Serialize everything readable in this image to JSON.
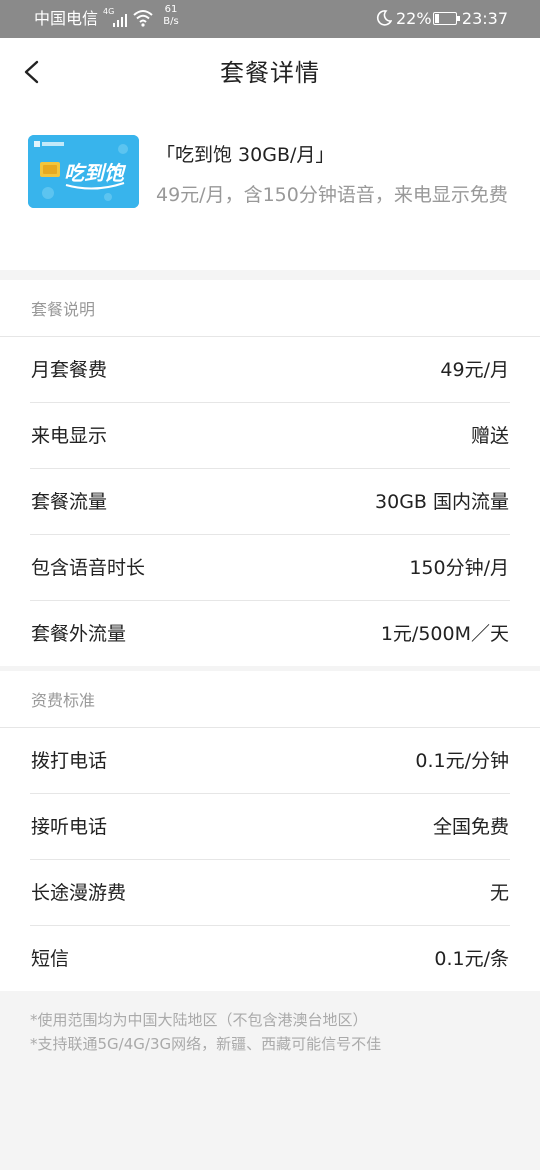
{
  "status_bar": {
    "carrier": "中国电信",
    "network_type": "4G",
    "net_speed_value": "61",
    "net_speed_unit": "B/s",
    "battery_percent": "22%",
    "battery_level": 0.22,
    "time": "23:37",
    "icons": [
      "signal-icon",
      "wifi-icon",
      "moon-icon",
      "battery-icon"
    ]
  },
  "nav": {
    "title": "套餐详情",
    "back_icon": "chevron-left-icon"
  },
  "plan": {
    "name": "「吃到饱 30GB/月」",
    "description": "49元/月，含150分钟语音，来电显示免费",
    "image_text": "吃到饱"
  },
  "plan_info": {
    "header": "套餐说明",
    "rows": [
      {
        "label": "月套餐费",
        "value": "49元/月"
      },
      {
        "label": "来电显示",
        "value": "赠送"
      },
      {
        "label": "套餐流量",
        "value": "30GB 国内流量"
      },
      {
        "label": "包含语音时长",
        "value": "150分钟/月"
      },
      {
        "label": "套餐外流量",
        "value": "1元/500M／天"
      }
    ]
  },
  "tariff": {
    "header": "资费标准",
    "rows": [
      {
        "label": "拨打电话",
        "value": "0.1元/分钟"
      },
      {
        "label": "接听电话",
        "value": "全国免费"
      },
      {
        "label": "长途漫游费",
        "value": "无"
      },
      {
        "label": "短信",
        "value": "0.1元/条"
      }
    ]
  },
  "footnotes": [
    "*使用范围均为中国大陆地区（不包含港澳台地区）",
    "*支持联通5G/4G/3G网络，新疆、西藏可能信号不佳"
  ],
  "colors": {
    "status_bar_bg": "#8a8a8a",
    "card_bg": "#38b4ec",
    "page_bg": "#f4f4f4",
    "text_primary": "#222222",
    "text_secondary": "#999999"
  }
}
